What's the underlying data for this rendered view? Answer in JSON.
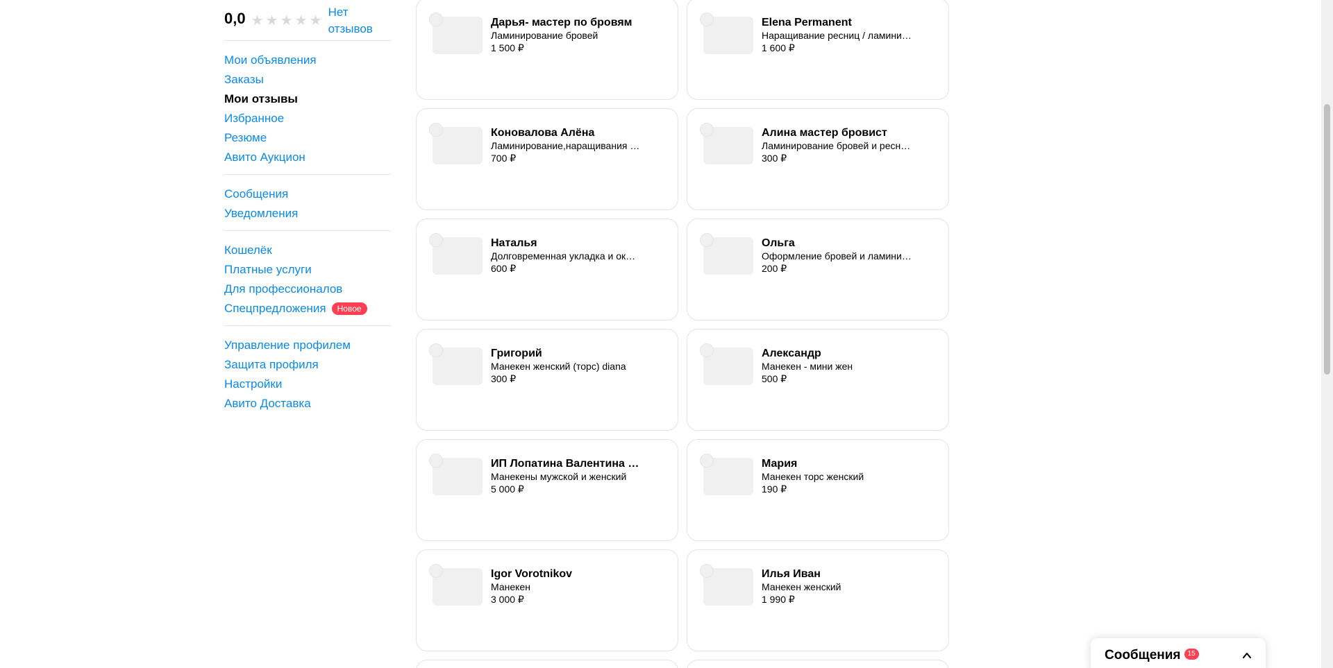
{
  "sidebar": {
    "rating": "0,0",
    "no_reviews": "Нет отзывов",
    "groups": [
      [
        {
          "label": "Мои объявления",
          "active": false
        },
        {
          "label": "Заказы",
          "active": false
        },
        {
          "label": "Мои отзывы",
          "active": true
        },
        {
          "label": "Избранное",
          "active": false
        },
        {
          "label": "Резюме",
          "active": false
        },
        {
          "label": "Авито Аукцион",
          "active": false
        }
      ],
      [
        {
          "label": "Сообщения",
          "active": false
        },
        {
          "label": "Уведомления",
          "active": false
        }
      ],
      [
        {
          "label": "Кошелёк",
          "active": false
        },
        {
          "label": "Платные услуги",
          "active": false
        },
        {
          "label": "Для профессионалов",
          "active": false
        },
        {
          "label": "Спецпредложения",
          "active": false,
          "badge": "Новое"
        }
      ],
      [
        {
          "label": "Управление профилем",
          "active": false
        },
        {
          "label": "Защита профиля",
          "active": false
        },
        {
          "label": "Настройки",
          "active": false
        },
        {
          "label": "Авито Доставка",
          "active": false
        }
      ]
    ]
  },
  "listings": [
    {
      "name": "Дарья- мастер по бровям",
      "service": "Ламинирование бровей",
      "price": "1 500 ₽"
    },
    {
      "name": "Elena Permanent",
      "service": "Наращивание ресниц / ламини…",
      "price": "1 600 ₽"
    },
    {
      "name": "Коновалова Алёна",
      "service": "Ламинирование,наращивания …",
      "price": "700 ₽"
    },
    {
      "name": "Алина мастер бровист",
      "service": "Ламинирование бровей и ресн…",
      "price": "300 ₽"
    },
    {
      "name": "Наталья",
      "service": "Долговременная укладка и ок…",
      "price": "600 ₽"
    },
    {
      "name": "Ольга",
      "service": "Оформление бровей и ламини…",
      "price": "200 ₽"
    },
    {
      "name": "Григорий",
      "service": "Манекен женский (торс) diana",
      "price": "300 ₽"
    },
    {
      "name": "Александр",
      "service": "Манекен - мини жен",
      "price": "500 ₽"
    },
    {
      "name": "ИП Лопатина Валентина …",
      "service": "Манекены мужской и женский",
      "price": "5 000 ₽"
    },
    {
      "name": "Мария",
      "service": "Манекен торс женский",
      "price": "190 ₽"
    },
    {
      "name": "Igor Vorotnikov",
      "service": "Манекен",
      "price": "3 000 ₽"
    },
    {
      "name": "Илья Иван",
      "service": "Манекен женский",
      "price": "1 990 ₽"
    }
  ],
  "messages_widget": {
    "title": "Сообщения",
    "count": "15"
  },
  "colors": {
    "link": "#0a8ae8",
    "badge": "#ff4053",
    "star_empty": "#d9d9d9"
  }
}
